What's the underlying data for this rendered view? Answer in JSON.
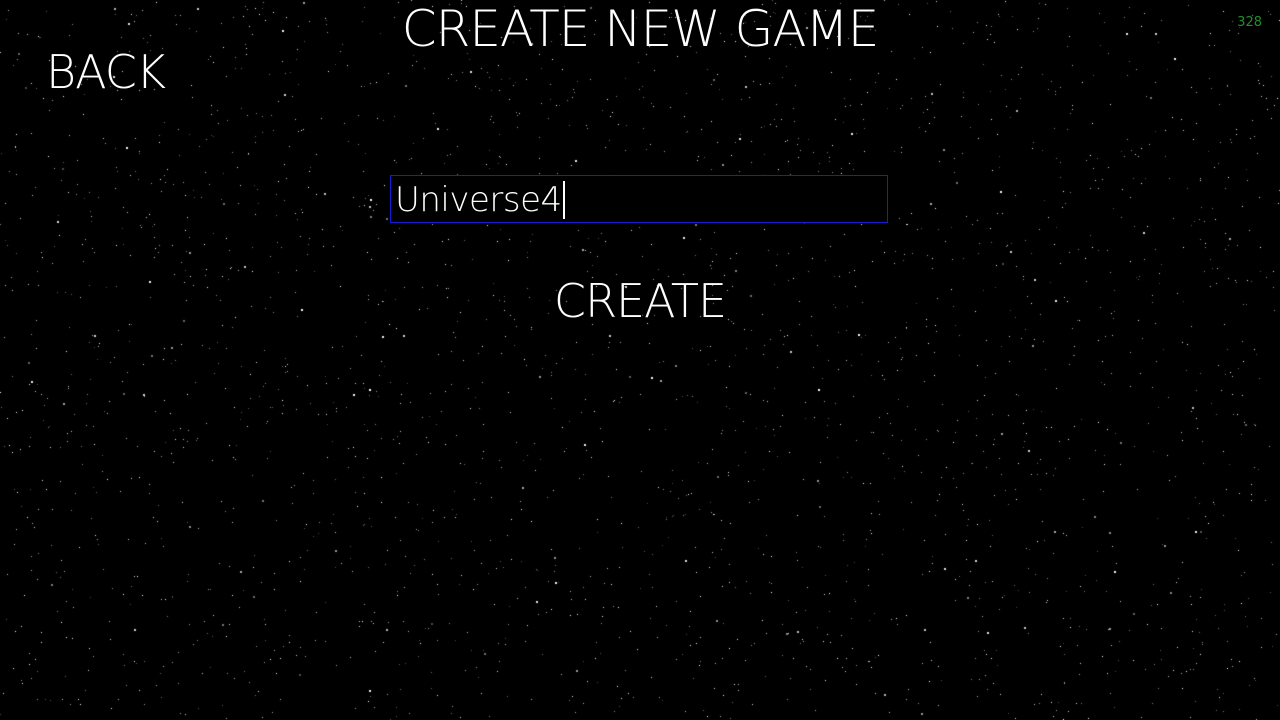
{
  "screen": {
    "title": "CREATE NEW GAME",
    "back_label": "BACK",
    "fps": "328"
  },
  "form": {
    "game_name_value": "Universe4",
    "create_label": "CREATE"
  },
  "colors": {
    "background": "#000000",
    "text": "#ffffff",
    "input_border": "#1a1ad2",
    "fps_counter": "#1f8f2a"
  }
}
